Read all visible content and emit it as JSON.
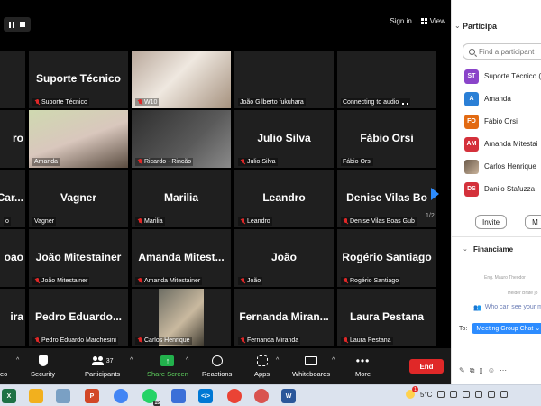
{
  "topbar": {
    "sign_in": "Sign in",
    "view": "View"
  },
  "tiles": [
    {
      "name": "",
      "label": ""
    },
    {
      "name": "Suporte Técnico",
      "label": "Suporte Técnico",
      "muted": true
    },
    {
      "name": "",
      "label": "W10",
      "muted": true,
      "video": true
    },
    {
      "name": "",
      "label": "João Gilberto fukuhara",
      "muted": false
    },
    {
      "name": "",
      "label": "Connecting to audio",
      "muted": false
    },
    {
      "name": "ro",
      "label": ""
    },
    {
      "name": "",
      "label": "Amanda",
      "muted": false,
      "video": true,
      "active": true
    },
    {
      "name": "",
      "label": "Ricardo - Rincão",
      "muted": true,
      "video": true
    },
    {
      "name": "Julio Silva",
      "label": "Julio Silva",
      "muted": true
    },
    {
      "name": "Fábio Orsi",
      "label": "Fábio Orsi",
      "muted": false
    },
    {
      "name": "Car...",
      "label": "o"
    },
    {
      "name": "Vagner",
      "label": "Vagner",
      "muted": false
    },
    {
      "name": "Marilia",
      "label": "Marilia",
      "muted": true
    },
    {
      "name": "Leandro",
      "label": "Leandro",
      "muted": true
    },
    {
      "name": "Denise Vilas Bo",
      "label": "Denise Vilas Boas Gub",
      "muted": true
    },
    {
      "name": "oao",
      "label": ""
    },
    {
      "name": "João Mitestainer",
      "label": "João Mitestainer",
      "muted": true
    },
    {
      "name": "Amanda Mitest...",
      "label": "Amanda Mitestainer",
      "muted": true
    },
    {
      "name": "João",
      "label": "João",
      "muted": true
    },
    {
      "name": "Rogério Santiago",
      "label": "Rogério Santiago",
      "muted": true
    },
    {
      "name": "ira",
      "label": ""
    },
    {
      "name": "Pedro Eduardo...",
      "label": "Pedro Eduardo Marchesini",
      "muted": true
    },
    {
      "name": "",
      "label": "Carlos Henrique",
      "muted": true,
      "video": true
    },
    {
      "name": "Fernanda Miran...",
      "label": "Fernanda Miranda",
      "muted": true
    },
    {
      "name": "Laura Pestana",
      "label": "Laura Pestana",
      "muted": true
    }
  ],
  "page_indicator": "1/2",
  "toolbar": {
    "video": "eo",
    "security": "Security",
    "participants": "Participants",
    "participants_count": "37",
    "share": "Share Screen",
    "reactions": "Reactions",
    "apps": "Apps",
    "whiteboards": "Whiteboards",
    "more": "More",
    "end": "End"
  },
  "panel": {
    "title": "Participa",
    "search_placeholder": "Find a participant",
    "participants": [
      {
        "initials": "ST",
        "name": "Suporte Técnico (",
        "color": "#8a44c9"
      },
      {
        "initials": "A",
        "name": "Amanda",
        "color": "#2a7fd6"
      },
      {
        "initials": "FO",
        "name": "Fábio Orsi",
        "color": "#e26a12"
      },
      {
        "initials": "AM",
        "name": "Amanda Mitestai",
        "color": "#d4313b"
      },
      {
        "initials": "",
        "name": "Carlos Henrique",
        "color": "#8d7b66",
        "photo": true
      },
      {
        "initials": "DS",
        "name": "Danilo Stafuzza",
        "color": "#d4313b"
      }
    ],
    "invite": "Invite",
    "mute_all": "M",
    "chat_title": "Financiame",
    "chat_lines": [
      "Eng. Mauro Theodor",
      "Helder Brate jo"
    ],
    "who_see": "Who can see your m",
    "to_label": "To:",
    "to_value": "Meeting Group Chat"
  },
  "taskbar": {
    "weather": "5°C",
    "weather_badge": "1",
    "whatsapp_badge": "15"
  }
}
